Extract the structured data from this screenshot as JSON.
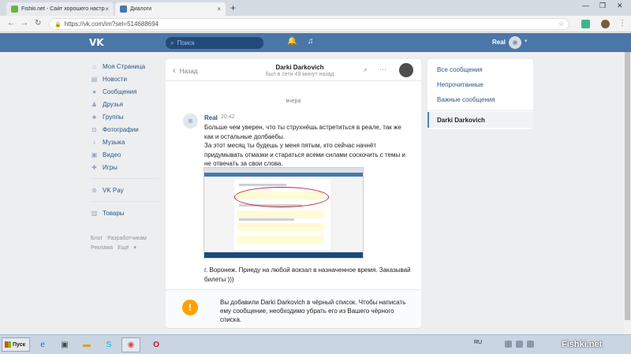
{
  "browser": {
    "tabs": [
      {
        "title": "Fishki.net - Сайт хорошего настро",
        "favicon": "fishki-favicon-icon",
        "active": false
      },
      {
        "title": "Диалоги",
        "favicon": "vk-favicon-icon",
        "active": true
      }
    ],
    "url": "https://vk.com/im?sel=514688694"
  },
  "vk_header": {
    "search_placeholder": "Поиск",
    "user_name": "Real"
  },
  "left_menu": {
    "items": [
      {
        "label": "Моя Страница",
        "icon": "home-icon"
      },
      {
        "label": "Новости",
        "icon": "news-icon"
      },
      {
        "label": "Сообщения",
        "icon": "messages-icon"
      },
      {
        "label": "Друзья",
        "icon": "friends-icon"
      },
      {
        "label": "Группы",
        "icon": "groups-icon"
      },
      {
        "label": "Фотографии",
        "icon": "photos-icon"
      },
      {
        "label": "Музыка",
        "icon": "music-icon"
      },
      {
        "label": "Видео",
        "icon": "video-icon"
      },
      {
        "label": "Игры",
        "icon": "games-icon"
      }
    ],
    "vkpay": "VK Pay",
    "goods": "Товары",
    "footer": [
      "Блог",
      "Разработчикам",
      "Реклама",
      "Ещё"
    ]
  },
  "chat": {
    "back_label": "Назад",
    "peer_name": "Darki Darkovich",
    "peer_status": "был в сети 49 минут назад",
    "day_label": "вчера",
    "message": {
      "author": "Real",
      "time": "20:42",
      "paragraphs": [
        "Больше чем уверен, что ты струхнёшь встретиться в реале, так же как и остальные долбаебы.",
        "За этот месяц ты будешь у меня пятым, кто сейчас начнёт придумывать отмазки и стараться всеми силами соскочить с темы и не отвечать за свои слова."
      ],
      "after_image": "г. Воронеж. Приеду на любой вокзал в назначенное время. Заказывай билеты )))"
    },
    "blocked_notice": "Вы добавили Darki Darkovich в чёрный список. Чтобы написать ему сообщение, необходимо убрать его из Вашего чёрного списка."
  },
  "filters": {
    "items": [
      "Все сообщения",
      "Непрочитанные",
      "Важные сообщения"
    ],
    "active_peer": "Darki Darkovich"
  },
  "taskbar": {
    "start_label": "Пуск",
    "lang": "RU",
    "watermark": "Fishki.net"
  }
}
